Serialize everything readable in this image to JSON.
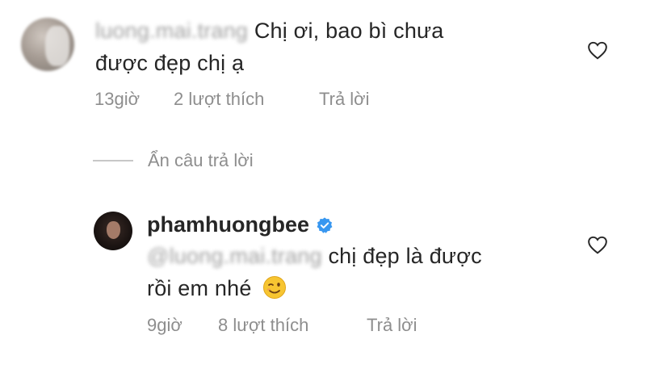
{
  "comments": [
    {
      "username": "luong.mai.trang",
      "text_line1": "Chị ơi, bao bì chưa",
      "text_line2": "được đẹp chị ạ",
      "time": "13giờ",
      "likes": "2 lượt thích",
      "reply_label": "Trả lời",
      "like_icon": "heart-outline-icon"
    },
    {
      "username": "phamhuongbee",
      "verified_icon": "verified-badge-icon",
      "mention": "@luong.mai.trang",
      "text_line1": "chị đẹp là được",
      "text_line2": "rồi em nhé",
      "emoji": "winking-face-emoji",
      "time": "9giờ",
      "likes": "8 lượt thích",
      "reply_label": "Trả lời",
      "like_icon": "heart-outline-icon"
    }
  ],
  "hide_replies_label": "Ẩn câu trả lời",
  "colors": {
    "text": "#262626",
    "meta": "#8e8e8e",
    "verified": "#3897f0"
  }
}
